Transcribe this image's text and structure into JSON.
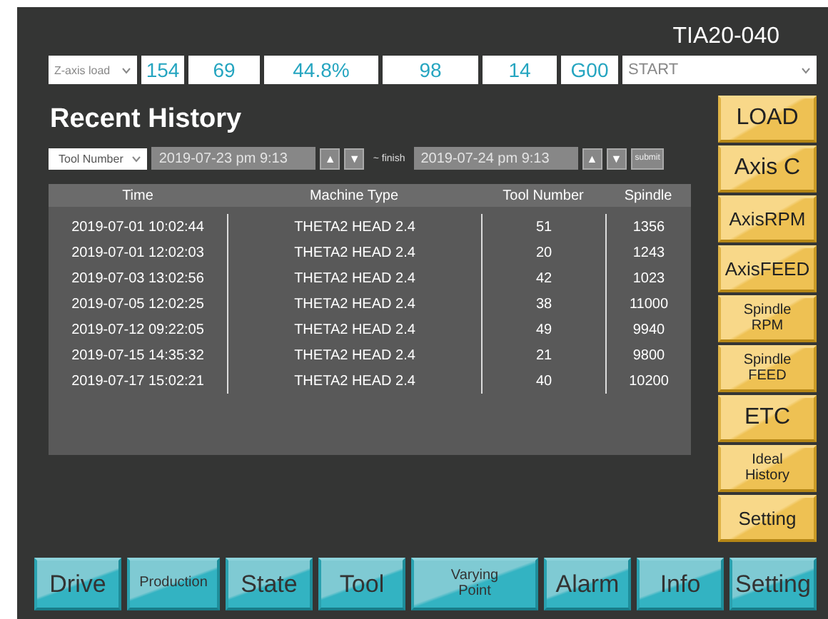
{
  "machine_id": "TIA20-040",
  "status_bar": {
    "metric_select": "Z-axis load",
    "readings": [
      "154",
      "69",
      "44.8%",
      "98",
      "14",
      "G00"
    ],
    "mode_select": "START"
  },
  "title": "Recent History",
  "filter": {
    "field_select": "Tool Number",
    "start": "2019-07-23  pm 9:13",
    "separator": "~ finish",
    "end": "2019-07-24  pm 9:13",
    "up": "▲",
    "down": "▼",
    "submit": "submit"
  },
  "table": {
    "columns": [
      "Time",
      "Machine Type",
      "Tool Number",
      "Spindle"
    ],
    "rows": [
      [
        "2019-07-01 10:02:44",
        "THETA2 HEAD 2.4",
        "51",
        "1356"
      ],
      [
        "2019-07-01 12:02:03",
        "THETA2 HEAD 2.4",
        "20",
        "1243"
      ],
      [
        "2019-07-03 13:02:56",
        "THETA2 HEAD 2.4",
        "42",
        "1023"
      ],
      [
        "2019-07-05 12:02:25",
        "THETA2 HEAD 2.4",
        "38",
        "11000"
      ],
      [
        "2019-07-12 09:22:05",
        "THETA2 HEAD 2.4",
        "49",
        "9940"
      ],
      [
        "2019-07-15 14:35:32",
        "THETA2 HEAD 2.4",
        "21",
        "9800"
      ],
      [
        "2019-07-17 15:02:21",
        "THETA2 HEAD 2.4",
        "40",
        "10200"
      ]
    ]
  },
  "side_menu": [
    {
      "label": "LOAD"
    },
    {
      "label": "Axis C"
    },
    {
      "label": "AxisRPM"
    },
    {
      "label": "AxisFEED"
    },
    {
      "label": "Spindle RPM"
    },
    {
      "label": "Spindle FEED"
    },
    {
      "label": "ETC"
    },
    {
      "label": "Ideal History"
    },
    {
      "label": "Setting"
    }
  ],
  "bottom_nav": [
    {
      "label": "Drive"
    },
    {
      "label": "Production"
    },
    {
      "label": "State"
    },
    {
      "label": "Tool"
    },
    {
      "label": "Varying Point"
    },
    {
      "label": "Alarm"
    },
    {
      "label": "Info"
    },
    {
      "label": "Setting"
    }
  ]
}
